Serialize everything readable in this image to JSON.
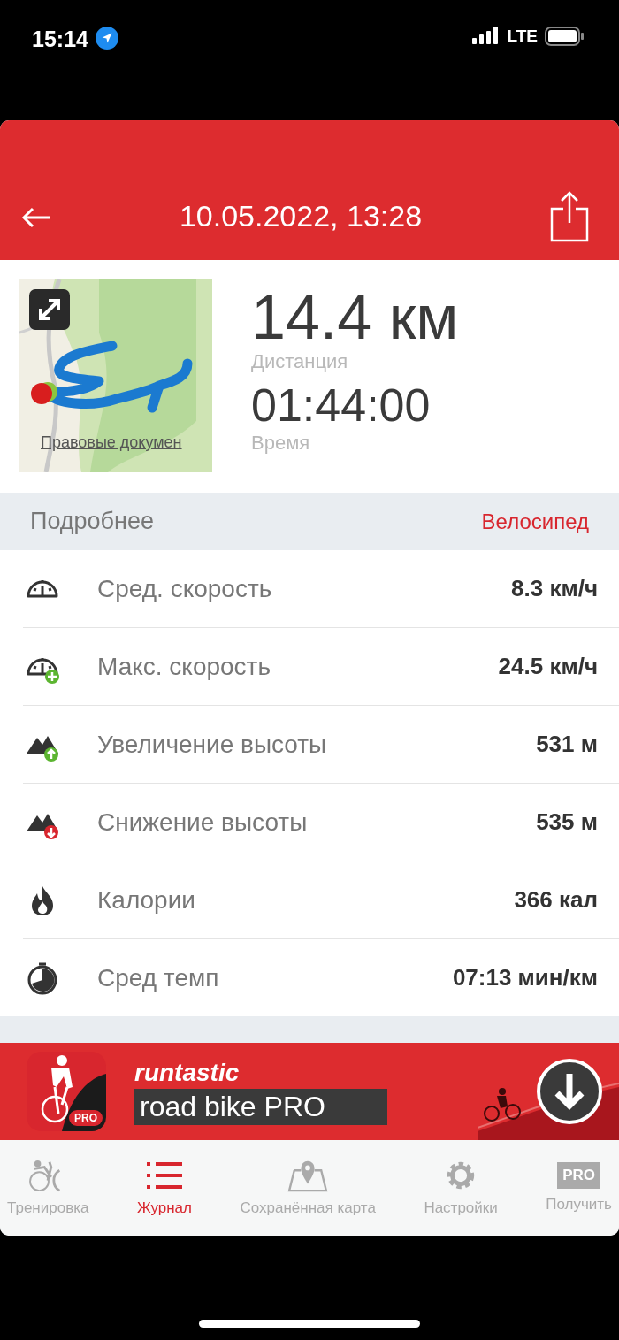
{
  "status_bar": {
    "time": "15:14",
    "network": "LTE"
  },
  "header": {
    "title": "10.05.2022, 13:28"
  },
  "summary": {
    "map_link": "Правовые докумен",
    "stats": [
      {
        "value": "14.4 км",
        "label": "Дистанция"
      },
      {
        "value": "01:44:00",
        "label": "Время"
      }
    ]
  },
  "section": {
    "title": "Подробнее",
    "sport": "Велосипед"
  },
  "metrics": [
    {
      "kind": "speed",
      "label": "Сред. скорость",
      "value": "8.3 км/ч"
    },
    {
      "kind": "max-speed",
      "label": "Макс. скорость",
      "value": "24.5 км/ч"
    },
    {
      "kind": "ascent",
      "label": "Увеличение высоты",
      "value": "531 м"
    },
    {
      "kind": "descent",
      "label": "Снижение высоты",
      "value": "535 м"
    },
    {
      "kind": "calories",
      "label": "Калории",
      "value": "366 кал"
    },
    {
      "kind": "pace",
      "label": "Сред темп",
      "value": "07:13 мин/км"
    }
  ],
  "ad": {
    "badge": "PRO",
    "brand": "runtastic",
    "product": "road bike PRO"
  },
  "tabs": [
    {
      "kind": "workout",
      "label": "Тренировка",
      "selected": false
    },
    {
      "kind": "journal",
      "label": "Журнал",
      "selected": true
    },
    {
      "kind": "maps",
      "label": "Сохранённая карта",
      "selected": false
    },
    {
      "kind": "settings",
      "label": "Настройки",
      "selected": false
    },
    {
      "kind": "pro",
      "label": "Получить",
      "badge": "PRO",
      "selected": false
    }
  ]
}
